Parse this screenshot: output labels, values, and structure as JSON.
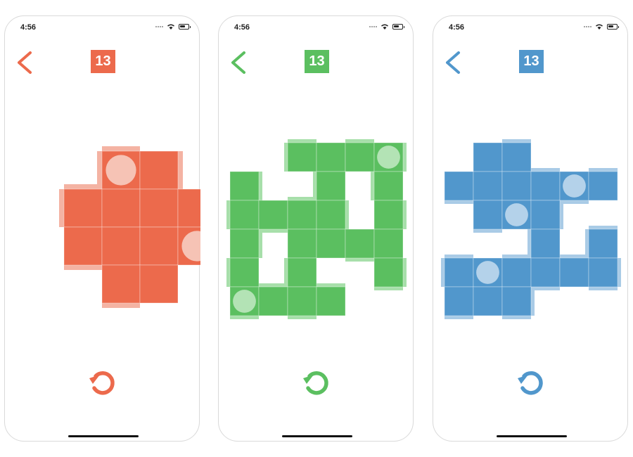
{
  "screens": [
    {
      "status_time": "4:56",
      "level": "13",
      "color": "#ec6a4c",
      "tile_light": "#f4b3a3",
      "ball_color": "#f6c3b5",
      "icons": {
        "back": "chevron-left-icon",
        "reset": "restart-icon",
        "wifi": "wifi-icon",
        "battery": "battery-icon"
      },
      "board": {
        "tiles": [
          {
            "col": 2,
            "row": 0
          },
          {
            "col": 3,
            "row": 0
          },
          {
            "col": 1,
            "row": 1
          },
          {
            "col": 2,
            "row": 1
          },
          {
            "col": 3,
            "row": 1
          },
          {
            "col": 4,
            "row": 1
          },
          {
            "col": 1,
            "row": 2
          },
          {
            "col": 2,
            "row": 2
          },
          {
            "col": 3,
            "row": 2
          },
          {
            "col": 4,
            "row": 2
          },
          {
            "col": 2,
            "row": 3
          },
          {
            "col": 3,
            "row": 3
          }
        ],
        "balls": [
          {
            "col": 2,
            "row": 0
          },
          {
            "col": 4,
            "row": 2
          }
        ]
      }
    },
    {
      "status_time": "4:56",
      "level": "13",
      "color": "#5bbf60",
      "tile_light": "#a7dfaa",
      "ball_color": "#b3e3b5",
      "icons": {
        "back": "chevron-left-icon",
        "reset": "restart-icon",
        "wifi": "wifi-icon",
        "battery": "battery-icon"
      },
      "board": {
        "tiles": [
          {
            "col": 2,
            "row": 0
          },
          {
            "col": 3,
            "row": 0
          },
          {
            "col": 4,
            "row": 0
          },
          {
            "col": 5,
            "row": 0
          },
          {
            "col": 0,
            "row": 1
          },
          {
            "col": 3,
            "row": 1
          },
          {
            "col": 5,
            "row": 1
          },
          {
            "col": 0,
            "row": 2
          },
          {
            "col": 1,
            "row": 2
          },
          {
            "col": 2,
            "row": 2
          },
          {
            "col": 3,
            "row": 2
          },
          {
            "col": 5,
            "row": 2
          },
          {
            "col": 0,
            "row": 3
          },
          {
            "col": 2,
            "row": 3
          },
          {
            "col": 3,
            "row": 3
          },
          {
            "col": 4,
            "row": 3
          },
          {
            "col": 5,
            "row": 3
          },
          {
            "col": 0,
            "row": 4
          },
          {
            "col": 2,
            "row": 4
          },
          {
            "col": 5,
            "row": 4
          },
          {
            "col": 0,
            "row": 5
          },
          {
            "col": 1,
            "row": 5
          },
          {
            "col": 2,
            "row": 5
          },
          {
            "col": 3,
            "row": 5
          }
        ],
        "balls": [
          {
            "col": 5,
            "row": 0
          },
          {
            "col": 0,
            "row": 5
          }
        ]
      }
    },
    {
      "status_time": "4:56",
      "level": "13",
      "color": "#5197cc",
      "tile_light": "#a9cbe6",
      "ball_color": "#b4d2ea",
      "icons": {
        "back": "chevron-left-icon",
        "reset": "restart-icon",
        "wifi": "wifi-icon",
        "battery": "battery-icon"
      },
      "board": {
        "tiles": [
          {
            "col": 1,
            "row": 0
          },
          {
            "col": 2,
            "row": 0
          },
          {
            "col": 0,
            "row": 1
          },
          {
            "col": 1,
            "row": 1
          },
          {
            "col": 2,
            "row": 1
          },
          {
            "col": 3,
            "row": 1
          },
          {
            "col": 4,
            "row": 1
          },
          {
            "col": 5,
            "row": 1
          },
          {
            "col": 1,
            "row": 2
          },
          {
            "col": 2,
            "row": 2
          },
          {
            "col": 3,
            "row": 2
          },
          {
            "col": 3,
            "row": 3
          },
          {
            "col": 5,
            "row": 3
          },
          {
            "col": 0,
            "row": 4
          },
          {
            "col": 1,
            "row": 4
          },
          {
            "col": 2,
            "row": 4
          },
          {
            "col": 3,
            "row": 4
          },
          {
            "col": 4,
            "row": 4
          },
          {
            "col": 5,
            "row": 4
          },
          {
            "col": 0,
            "row": 5
          },
          {
            "col": 1,
            "row": 5
          },
          {
            "col": 2,
            "row": 5
          }
        ],
        "balls": [
          {
            "col": 4,
            "row": 1
          },
          {
            "col": 2,
            "row": 2
          },
          {
            "col": 1,
            "row": 4
          }
        ]
      }
    }
  ]
}
